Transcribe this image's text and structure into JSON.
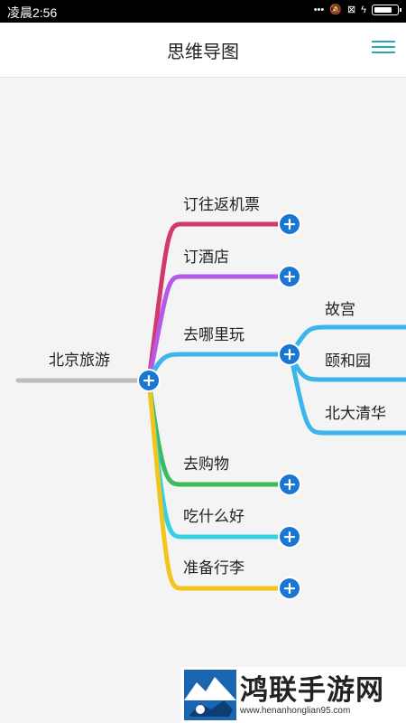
{
  "status_bar": {
    "time": "凌晨2:56",
    "icons": [
      "dots-icon",
      "mute-icon",
      "sim-off-icon",
      "charging-icon",
      "battery-icon"
    ],
    "battery_level": 0.8
  },
  "app_bar": {
    "title": "思维导图",
    "menu_icon": "hamburger-menu-icon",
    "accent_color": "#2aa9b4"
  },
  "mindmap": {
    "root": {
      "label": "北京旅游",
      "line_color": "#bdbdbd"
    },
    "branches": [
      {
        "label": "订往返机票",
        "color": "#d2386c"
      },
      {
        "label": "订酒店",
        "color": "#b45ae6"
      },
      {
        "label": "去哪里玩",
        "color": "#3bb5ea",
        "children": [
          {
            "label": "故宫"
          },
          {
            "label": "颐和园"
          },
          {
            "label": "北大清华"
          }
        ]
      },
      {
        "label": "去购物",
        "color": "#3dba5c"
      },
      {
        "label": "吃什么好",
        "color": "#34d0e3"
      },
      {
        "label": "准备行李",
        "color": "#f2c41c"
      }
    ],
    "plus_button_color": "#1976d2"
  },
  "watermark": {
    "text": "鸿联手游网",
    "url": "www.henanhonglian95.com"
  }
}
